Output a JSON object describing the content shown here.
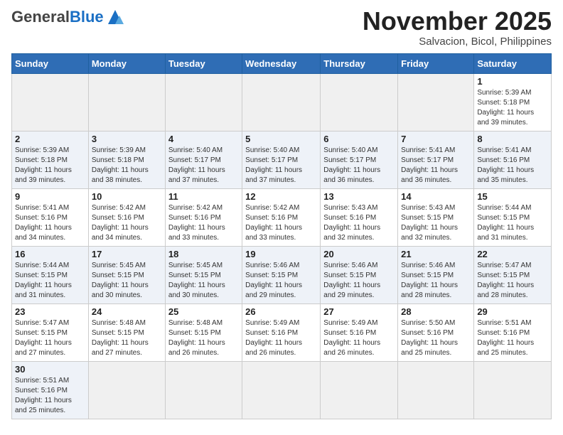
{
  "header": {
    "logo_general": "General",
    "logo_blue": "Blue",
    "month_title": "November 2025",
    "location": "Salvacion, Bicol, Philippines"
  },
  "weekdays": [
    "Sunday",
    "Monday",
    "Tuesday",
    "Wednesday",
    "Thursday",
    "Friday",
    "Saturday"
  ],
  "weeks": [
    [
      {
        "day": "",
        "info": ""
      },
      {
        "day": "",
        "info": ""
      },
      {
        "day": "",
        "info": ""
      },
      {
        "day": "",
        "info": ""
      },
      {
        "day": "",
        "info": ""
      },
      {
        "day": "",
        "info": ""
      },
      {
        "day": "1",
        "info": "Sunrise: 5:39 AM\nSunset: 5:18 PM\nDaylight: 11 hours\nand 39 minutes."
      }
    ],
    [
      {
        "day": "2",
        "info": "Sunrise: 5:39 AM\nSunset: 5:18 PM\nDaylight: 11 hours\nand 39 minutes."
      },
      {
        "day": "3",
        "info": "Sunrise: 5:39 AM\nSunset: 5:18 PM\nDaylight: 11 hours\nand 38 minutes."
      },
      {
        "day": "4",
        "info": "Sunrise: 5:40 AM\nSunset: 5:17 PM\nDaylight: 11 hours\nand 37 minutes."
      },
      {
        "day": "5",
        "info": "Sunrise: 5:40 AM\nSunset: 5:17 PM\nDaylight: 11 hours\nand 37 minutes."
      },
      {
        "day": "6",
        "info": "Sunrise: 5:40 AM\nSunset: 5:17 PM\nDaylight: 11 hours\nand 36 minutes."
      },
      {
        "day": "7",
        "info": "Sunrise: 5:41 AM\nSunset: 5:17 PM\nDaylight: 11 hours\nand 36 minutes."
      },
      {
        "day": "8",
        "info": "Sunrise: 5:41 AM\nSunset: 5:16 PM\nDaylight: 11 hours\nand 35 minutes."
      }
    ],
    [
      {
        "day": "9",
        "info": "Sunrise: 5:41 AM\nSunset: 5:16 PM\nDaylight: 11 hours\nand 34 minutes."
      },
      {
        "day": "10",
        "info": "Sunrise: 5:42 AM\nSunset: 5:16 PM\nDaylight: 11 hours\nand 34 minutes."
      },
      {
        "day": "11",
        "info": "Sunrise: 5:42 AM\nSunset: 5:16 PM\nDaylight: 11 hours\nand 33 minutes."
      },
      {
        "day": "12",
        "info": "Sunrise: 5:42 AM\nSunset: 5:16 PM\nDaylight: 11 hours\nand 33 minutes."
      },
      {
        "day": "13",
        "info": "Sunrise: 5:43 AM\nSunset: 5:16 PM\nDaylight: 11 hours\nand 32 minutes."
      },
      {
        "day": "14",
        "info": "Sunrise: 5:43 AM\nSunset: 5:15 PM\nDaylight: 11 hours\nand 32 minutes."
      },
      {
        "day": "15",
        "info": "Sunrise: 5:44 AM\nSunset: 5:15 PM\nDaylight: 11 hours\nand 31 minutes."
      }
    ],
    [
      {
        "day": "16",
        "info": "Sunrise: 5:44 AM\nSunset: 5:15 PM\nDaylight: 11 hours\nand 31 minutes."
      },
      {
        "day": "17",
        "info": "Sunrise: 5:45 AM\nSunset: 5:15 PM\nDaylight: 11 hours\nand 30 minutes."
      },
      {
        "day": "18",
        "info": "Sunrise: 5:45 AM\nSunset: 5:15 PM\nDaylight: 11 hours\nand 30 minutes."
      },
      {
        "day": "19",
        "info": "Sunrise: 5:46 AM\nSunset: 5:15 PM\nDaylight: 11 hours\nand 29 minutes."
      },
      {
        "day": "20",
        "info": "Sunrise: 5:46 AM\nSunset: 5:15 PM\nDaylight: 11 hours\nand 29 minutes."
      },
      {
        "day": "21",
        "info": "Sunrise: 5:46 AM\nSunset: 5:15 PM\nDaylight: 11 hours\nand 28 minutes."
      },
      {
        "day": "22",
        "info": "Sunrise: 5:47 AM\nSunset: 5:15 PM\nDaylight: 11 hours\nand 28 minutes."
      }
    ],
    [
      {
        "day": "23",
        "info": "Sunrise: 5:47 AM\nSunset: 5:15 PM\nDaylight: 11 hours\nand 27 minutes."
      },
      {
        "day": "24",
        "info": "Sunrise: 5:48 AM\nSunset: 5:15 PM\nDaylight: 11 hours\nand 27 minutes."
      },
      {
        "day": "25",
        "info": "Sunrise: 5:48 AM\nSunset: 5:15 PM\nDaylight: 11 hours\nand 26 minutes."
      },
      {
        "day": "26",
        "info": "Sunrise: 5:49 AM\nSunset: 5:16 PM\nDaylight: 11 hours\nand 26 minutes."
      },
      {
        "day": "27",
        "info": "Sunrise: 5:49 AM\nSunset: 5:16 PM\nDaylight: 11 hours\nand 26 minutes."
      },
      {
        "day": "28",
        "info": "Sunrise: 5:50 AM\nSunset: 5:16 PM\nDaylight: 11 hours\nand 25 minutes."
      },
      {
        "day": "29",
        "info": "Sunrise: 5:51 AM\nSunset: 5:16 PM\nDaylight: 11 hours\nand 25 minutes."
      }
    ],
    [
      {
        "day": "30",
        "info": "Sunrise: 5:51 AM\nSunset: 5:16 PM\nDaylight: 11 hours\nand 25 minutes."
      },
      {
        "day": "",
        "info": ""
      },
      {
        "day": "",
        "info": ""
      },
      {
        "day": "",
        "info": ""
      },
      {
        "day": "",
        "info": ""
      },
      {
        "day": "",
        "info": ""
      },
      {
        "day": "",
        "info": ""
      }
    ]
  ]
}
